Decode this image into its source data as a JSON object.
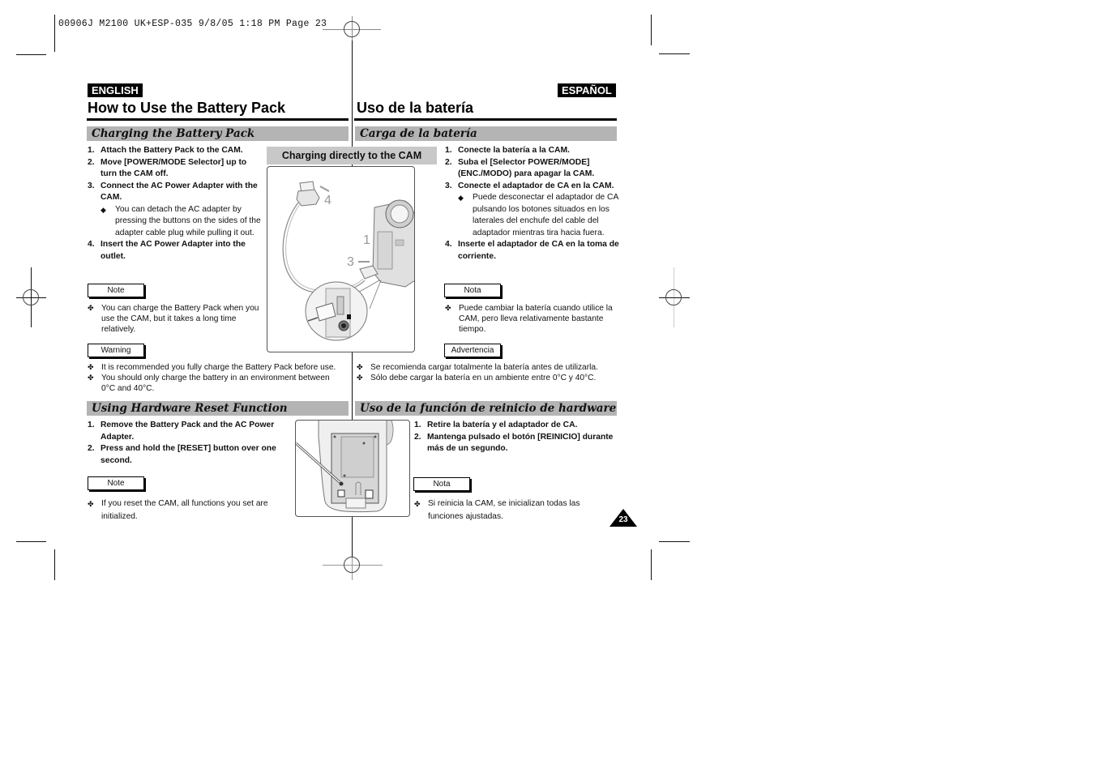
{
  "slug": "00906J M2100 UK+ESP-035  9/8/05 1:18 PM  Page 23",
  "english": {
    "badge": "ENGLISH",
    "title": "How to Use the Battery Pack",
    "charging": {
      "heading": "Charging the Battery Pack",
      "steps": [
        {
          "num": "1.",
          "text": "Attach the Battery Pack to the CAM."
        },
        {
          "num": "2.",
          "text": "Move [POWER/MODE Selector] up to turn the CAM off."
        },
        {
          "num": "3.",
          "text": "Connect the AC Power Adapter with the CAM."
        },
        {
          "num": "4.",
          "text": "Insert the AC Power Adapter into the outlet."
        }
      ],
      "sub_note": "You can detach the AC adapter by pressing the buttons on the sides of the adapter cable plug while pulling it out.",
      "note_label": "Note",
      "note_items": [
        "You can charge the Battery Pack when you use the CAM, but it takes a long time relatively."
      ],
      "warning_label": "Warning",
      "warning_items": [
        "It is recommended you fully charge the Battery Pack before use.",
        "You should only charge the battery in an environment between 0°C and 40°C."
      ]
    },
    "reset": {
      "heading": "Using Hardware Reset Function",
      "steps": [
        {
          "num": "1.",
          "text": "Remove the Battery Pack and the AC Power Adapter."
        },
        {
          "num": "2.",
          "text": "Press and hold the [RESET] button over one second."
        }
      ],
      "note_label": "Note",
      "note_items": [
        "If you reset the CAM, all functions you set are initialized."
      ]
    }
  },
  "spanish": {
    "badge": "ESPAÑOL",
    "title": "Uso de la batería",
    "charging": {
      "heading": "Carga de la batería",
      "steps": [
        {
          "num": "1.",
          "text": "Conecte la batería a la CAM."
        },
        {
          "num": "2.",
          "text": "Suba el [Selector POWER/MODE] (ENC./MODO) para apagar la CAM."
        },
        {
          "num": "3.",
          "text": "Conecte el adaptador de CA en la CAM."
        },
        {
          "num": "4.",
          "text": "Inserte el adaptador de CA en la toma de corriente."
        }
      ],
      "sub_note": "Puede desconectar el adaptador de CA pulsando los botones situados en los laterales del enchufe del cable del adaptador mientras tira hacia fuera.",
      "note_label": "Nota",
      "note_items": [
        "Puede cambiar la batería cuando utilice la CAM, pero lleva relativamente bastante tiempo."
      ],
      "warning_label": "Advertencia",
      "warning_items": [
        "Se recomienda cargar totalmente la batería antes de utilizarla.",
        "Sólo debe cargar la batería en un ambiente entre 0°C y 40°C."
      ]
    },
    "reset": {
      "heading": "Uso de la función de reinicio de hardware",
      "steps": [
        {
          "num": "1.",
          "text": "Retire la batería y el adaptador de CA."
        },
        {
          "num": "2.",
          "text": "Mantenga pulsado el botón [REINICIO] durante más de un segundo."
        }
      ],
      "note_label": "Nota",
      "note_items": [
        "Si reinicia la CAM, se inicializan todas las funciones ajustadas."
      ]
    }
  },
  "illustration": {
    "heading": "Charging directly to the CAM",
    "callouts": [
      "1",
      "3",
      "4"
    ]
  },
  "symbols": {
    "diamond": "◆",
    "cross": "✤"
  },
  "page_number": "23"
}
